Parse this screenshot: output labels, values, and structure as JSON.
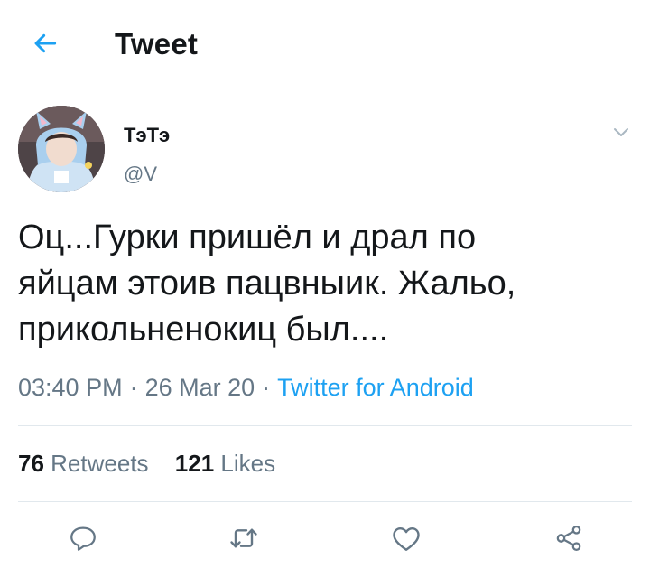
{
  "header": {
    "title": "Tweet",
    "back_icon": "arrow-left-icon",
    "accent_color": "#1da1f2"
  },
  "tweet": {
    "author": {
      "display_name": "ТэТэ",
      "handle": "@V",
      "avatar_icon": "avatar-photo"
    },
    "menu_icon": "chevron-down-icon",
    "text": "Оц...Гурки пришёл и драл по\nяйцам этоив пацвныик. Жальо,\nприкольненокиц был....",
    "time": "03:40 PM",
    "date": "26 Mar 20",
    "separator": "·",
    "source": "Twitter for Android"
  },
  "stats": {
    "retweets": {
      "count": "76",
      "label": "Retweets"
    },
    "likes": {
      "count": "121",
      "label": "Likes"
    }
  },
  "actions": [
    {
      "icon": "reply-icon"
    },
    {
      "icon": "retweet-icon"
    },
    {
      "icon": "like-icon"
    },
    {
      "icon": "share-icon"
    }
  ]
}
